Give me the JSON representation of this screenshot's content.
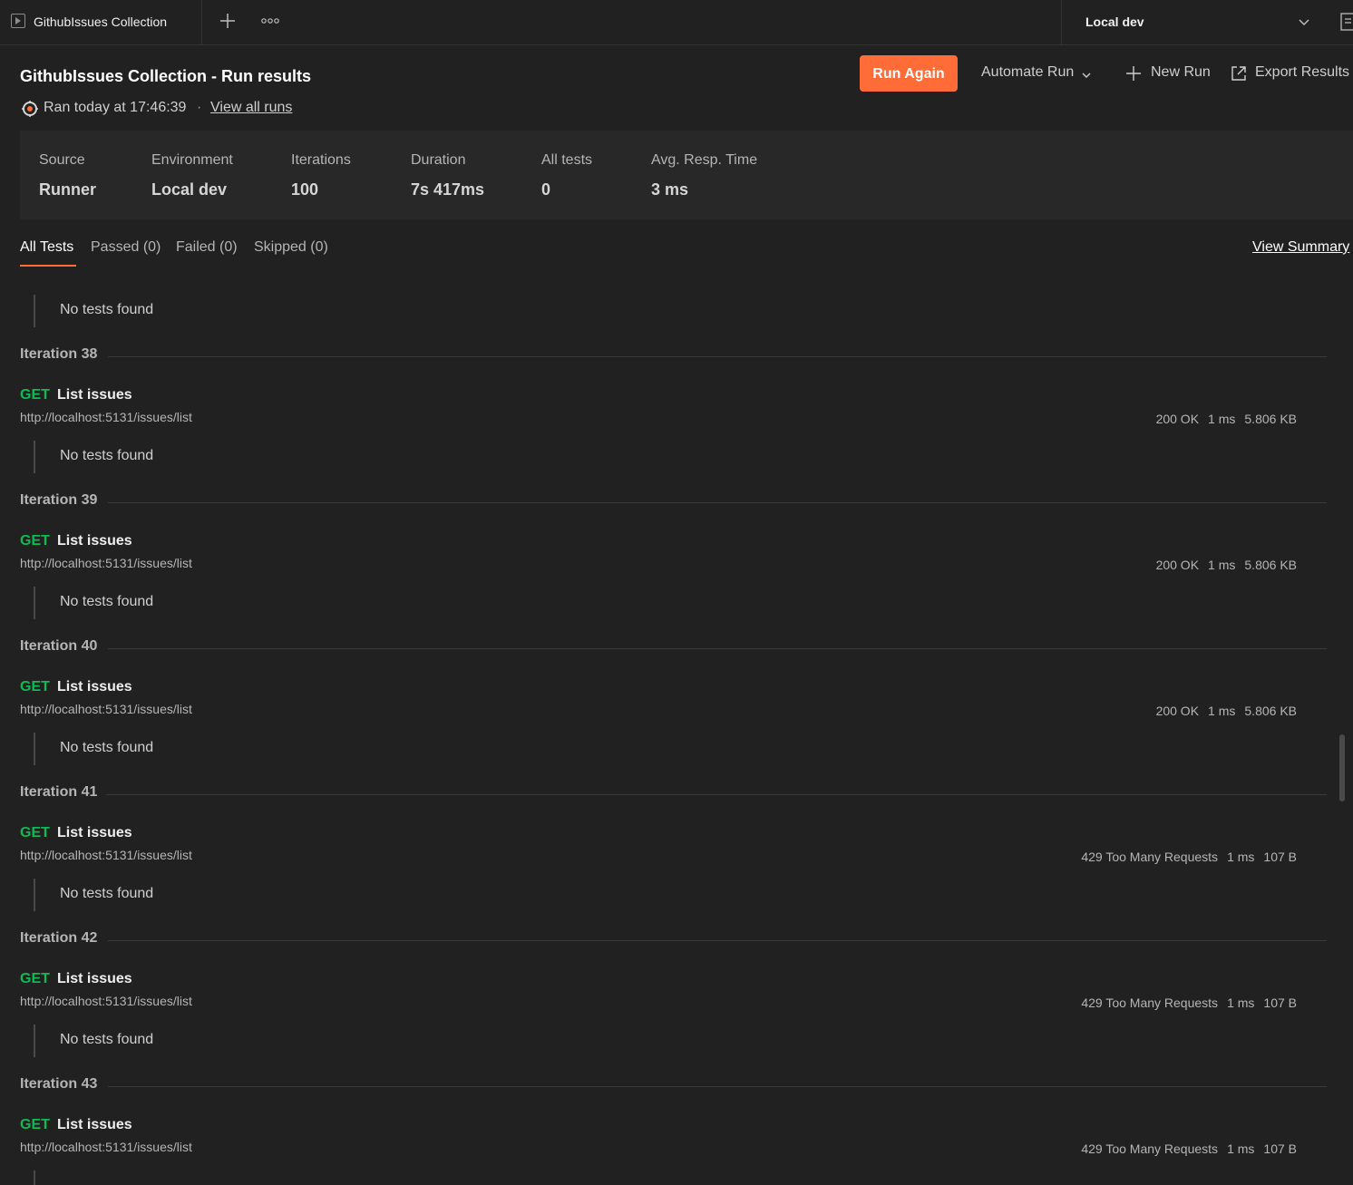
{
  "tab": {
    "title": "GithubIssues Collection"
  },
  "environment": {
    "selected": "Local dev"
  },
  "header": {
    "title": "GithubIssues Collection - Run results",
    "ran_text": "Ran today at 17:46:39",
    "separator": "·",
    "view_all_runs": "View all runs"
  },
  "actions": {
    "run_again": "Run Again",
    "automate_run": "Automate Run",
    "new_run": "New Run",
    "export_results": "Export Results"
  },
  "stats": [
    {
      "label": "Source",
      "value": "Runner"
    },
    {
      "label": "Environment",
      "value": "Local dev"
    },
    {
      "label": "Iterations",
      "value": "100"
    },
    {
      "label": "Duration",
      "value": "7s 417ms"
    },
    {
      "label": "All tests",
      "value": "0"
    },
    {
      "label": "Avg. Resp. Time",
      "value": "3 ms"
    }
  ],
  "filters": {
    "all": "All Tests",
    "passed": "Passed (0)",
    "failed": "Failed (0)",
    "skipped": "Skipped (0)",
    "view_summary": "View Summary"
  },
  "no_tests_text": "No tests found",
  "iterations": [
    {
      "label": "Iteration 38",
      "method": "GET",
      "name": "List issues",
      "url": "http://localhost:5131/issues/list",
      "status": "200 OK",
      "time": "1 ms",
      "size": "5.806 KB"
    },
    {
      "label": "Iteration 39",
      "method": "GET",
      "name": "List issues",
      "url": "http://localhost:5131/issues/list",
      "status": "200 OK",
      "time": "1 ms",
      "size": "5.806 KB"
    },
    {
      "label": "Iteration 40",
      "method": "GET",
      "name": "List issues",
      "url": "http://localhost:5131/issues/list",
      "status": "200 OK",
      "time": "1 ms",
      "size": "5.806 KB"
    },
    {
      "label": "Iteration 41",
      "method": "GET",
      "name": "List issues",
      "url": "http://localhost:5131/issues/list",
      "status": "429 Too Many Requests",
      "time": "1 ms",
      "size": "107 B"
    },
    {
      "label": "Iteration 42",
      "method": "GET",
      "name": "List issues",
      "url": "http://localhost:5131/issues/list",
      "status": "429 Too Many Requests",
      "time": "1 ms",
      "size": "107 B"
    },
    {
      "label": "Iteration 43",
      "method": "GET",
      "name": "List issues",
      "url": "http://localhost:5131/issues/list",
      "status": "429 Too Many Requests",
      "time": "1 ms",
      "size": "107 B"
    }
  ],
  "colors": {
    "accent": "#ff6c37",
    "get_method": "#0cbb52",
    "background": "#212121",
    "panel": "#282828"
  },
  "icons": [
    "runner-icon",
    "plus-icon",
    "more-icon",
    "chevron-down-icon",
    "environment-icon",
    "run-status-icon",
    "export-icon"
  ]
}
